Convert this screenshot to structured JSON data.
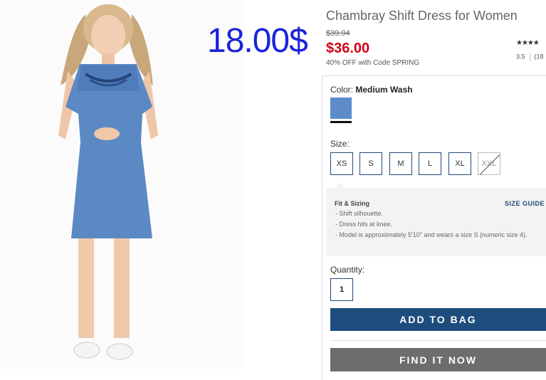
{
  "overlay": {
    "price_text": "18.00$"
  },
  "product": {
    "title": "Chambray Shift Dress for Women",
    "original_price": "$39.94",
    "sale_price": "$36.00",
    "promo_text": "40% OFF with Code SPRING",
    "stars_text": "★★★★",
    "rating_value": "3.5",
    "review_count": "(18",
    "image_icon": "product-photo-woman-in-denim-dress"
  },
  "color": {
    "label": "Color:",
    "selected": "Medium Wash",
    "swatch_hex": "#5c8cc9"
  },
  "size": {
    "label": "Size:",
    "options": [
      "XS",
      "S",
      "M",
      "L",
      "XL",
      "XXL"
    ],
    "unavailable": [
      "XXL"
    ]
  },
  "fit": {
    "title": "Fit & Sizing",
    "size_guide_label": "SIZE GUIDE",
    "items": [
      "- Shift silhouette.",
      "- Dress hits at knee.",
      "- Model is approxiimately 5'10\" and wears a size S (numeric size 4)."
    ]
  },
  "quantity": {
    "label": "Quantity:",
    "value": "1"
  },
  "actions": {
    "add_to_bag": "ADD TO BAG",
    "find_it_now": "FIND IT NOW"
  },
  "colors": {
    "sale_red": "#d0021b",
    "brand_navy": "#1d4d7c",
    "overlay_blue": "#1b23d8",
    "find_gray": "#6d6d6d"
  }
}
